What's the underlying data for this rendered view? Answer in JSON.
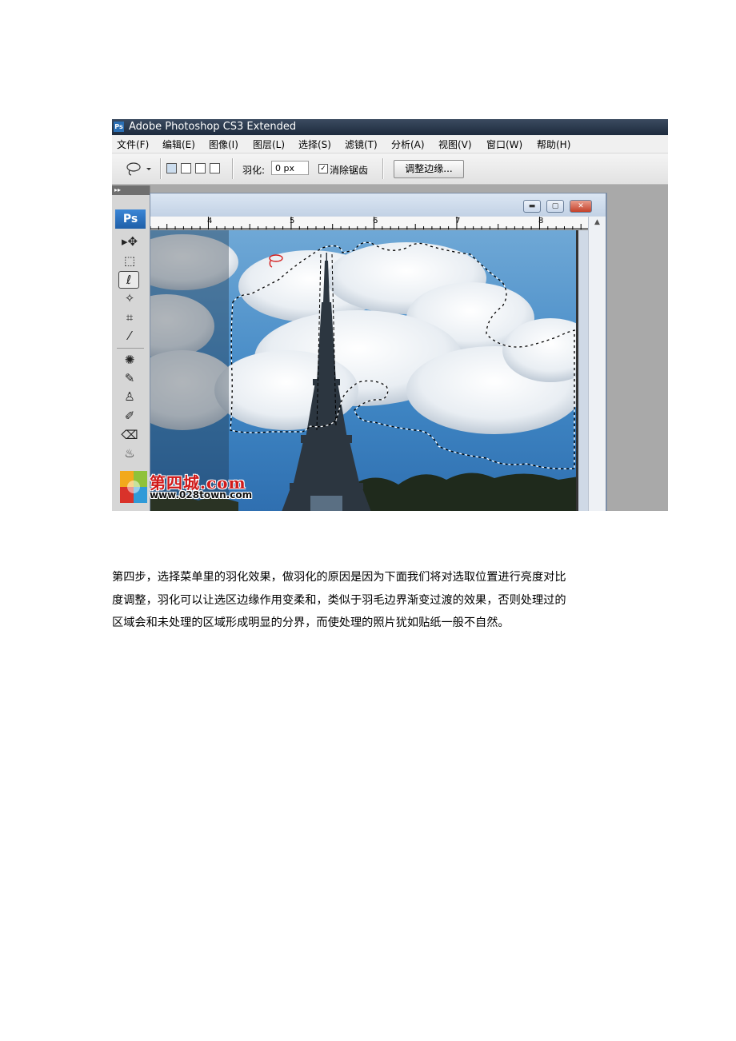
{
  "screenshot": {
    "app_icon": "Ps",
    "title": "Adobe Photoshop CS3 Extended",
    "menu": [
      "文件(F)",
      "编辑(E)",
      "图像(I)",
      "图层(L)",
      "选择(S)",
      "滤镜(T)",
      "分析(A)",
      "视图(V)",
      "窗口(W)",
      "帮助(H)"
    ],
    "options": {
      "tool_icon": "lasso-icon",
      "feather_label": "羽化:",
      "feather_value": "0 px",
      "antialias_checked": true,
      "antialias_label": "消除锯齿",
      "refine_edge_label": "调整边缘..."
    },
    "tools_logo": "Ps",
    "ruler_numbers": [
      "4",
      "5",
      "6",
      "7",
      "8"
    ],
    "window_buttons": [
      "minimize",
      "maximize",
      "close"
    ],
    "watermark": {
      "title": "第四城.com",
      "url": "www.028town.com"
    }
  },
  "paragraph": [
    "第四步，选择菜单里的羽化效果，做羽化的原因是因为下面我们将对选取位置进行亮度对比",
    "度调整，羽化可以让选区边缘作用变柔和，类似于羽毛边界渐变过渡的效果，否则处理过的",
    "区域会和未处理的区域形成明显的分界，而使处理的照片犹如贴纸一般不自然。"
  ]
}
